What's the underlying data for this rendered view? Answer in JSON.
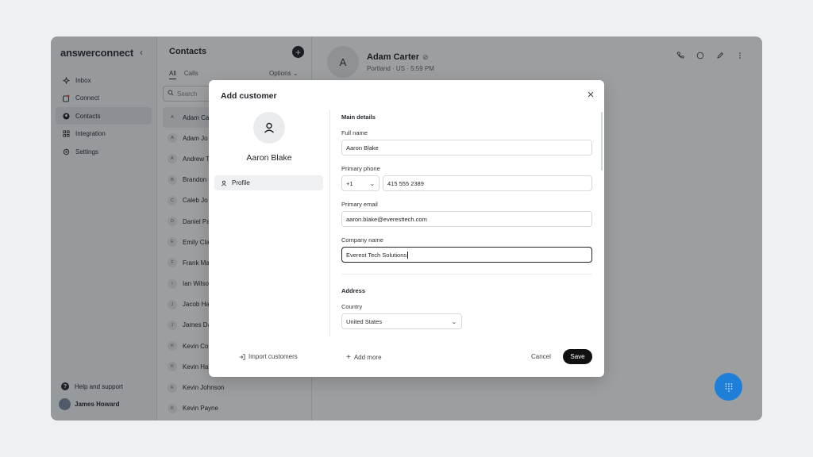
{
  "sidebar": {
    "logo": "answerconnect",
    "items": [
      {
        "label": "Inbox",
        "icon": "inbox-icon"
      },
      {
        "label": "Connect",
        "icon": "connect-icon"
      },
      {
        "label": "Contacts",
        "icon": "contacts-icon"
      },
      {
        "label": "Integration",
        "icon": "integration-icon"
      },
      {
        "label": "Settings",
        "icon": "settings-icon"
      }
    ],
    "help": "Help and support",
    "user": "James Howard"
  },
  "contacts": {
    "title": "Contacts",
    "tabs": [
      "All",
      "Calls"
    ],
    "options": "Options",
    "search_placeholder": "Search",
    "list": [
      {
        "initial": "A",
        "name": "Adam Ca"
      },
      {
        "initial": "A",
        "name": "Adam Jo"
      },
      {
        "initial": "A",
        "name": "Andrew T"
      },
      {
        "initial": "B",
        "name": "Brandon"
      },
      {
        "initial": "C",
        "name": "Caleb Jo"
      },
      {
        "initial": "D",
        "name": "Daniel Pa"
      },
      {
        "initial": "E",
        "name": "Emily Cla"
      },
      {
        "initial": "F",
        "name": "Frank Ma"
      },
      {
        "initial": "I",
        "name": "Ian Wilso"
      },
      {
        "initial": "J",
        "name": "Jacob Ha"
      },
      {
        "initial": "J",
        "name": "James Da"
      },
      {
        "initial": "K",
        "name": "Kevin Co"
      },
      {
        "initial": "K",
        "name": "Kevin Ha"
      },
      {
        "initial": "K",
        "name": "Kevin Johnson"
      },
      {
        "initial": "K",
        "name": "Kevin Payne"
      }
    ]
  },
  "main": {
    "avatar_initial": "A",
    "name": "Adam Carter",
    "sub": "Portland · US · 5:59 PM"
  },
  "modal": {
    "title": "Add customer",
    "avatar_name": "Aaron Blake",
    "nav_profile": "Profile",
    "main_details": "Main details",
    "full_name_label": "Full name",
    "full_name": "Aaron Blake",
    "phone_label": "Primary phone",
    "country_code": "+1",
    "phone": "415 555 2389",
    "email_label": "Primary email",
    "email": "aaron.blake@everesttech.com",
    "company_label": "Company name",
    "company": "Everest Tech Solutions",
    "address": "Address",
    "country_label": "Country",
    "country": "United States",
    "import": "Import customers",
    "add_more": "Add more",
    "cancel": "Cancel",
    "save": "Save"
  },
  "colors": {
    "accent_blue": "#1e7fd8",
    "primary_dark": "#111111"
  }
}
